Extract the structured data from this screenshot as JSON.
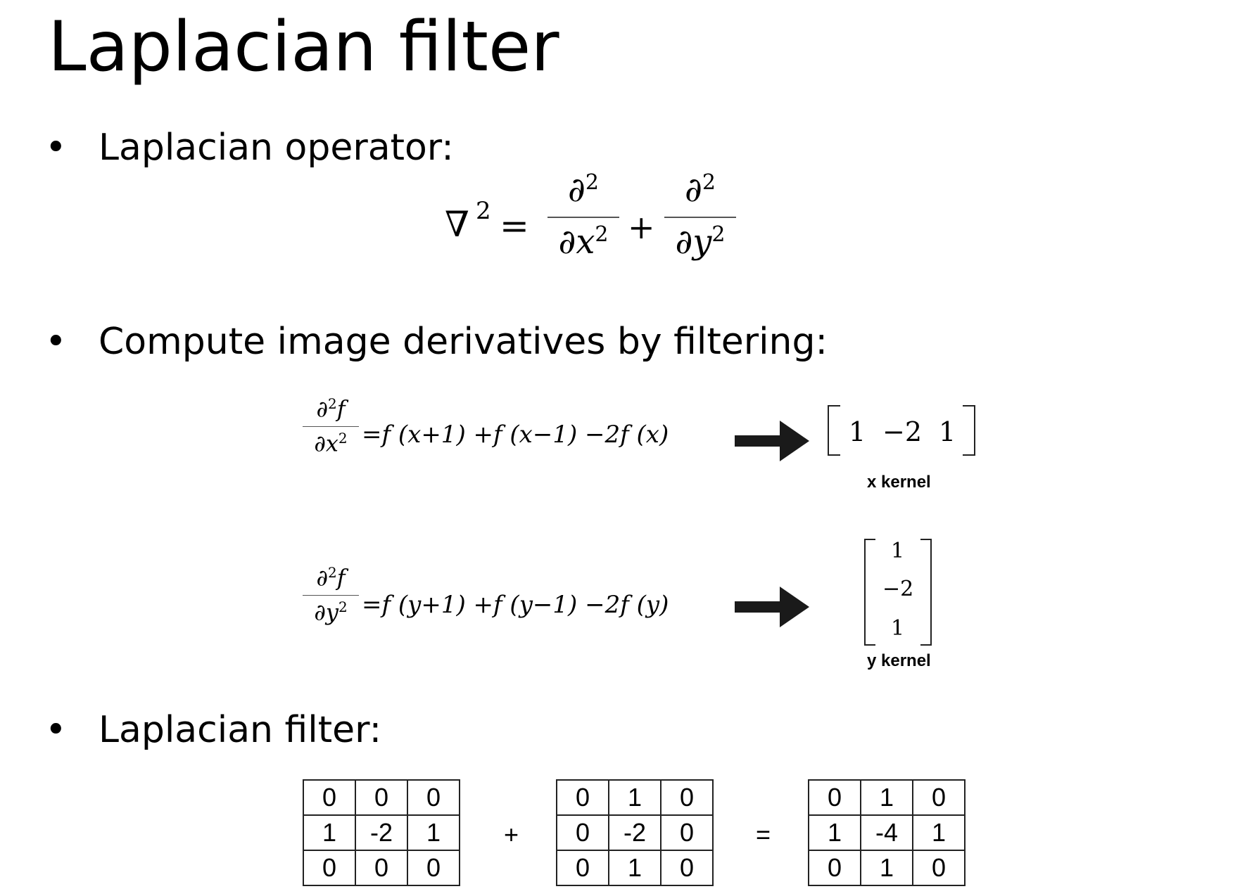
{
  "title": "Laplacian filter",
  "bullets": [
    {
      "marker": "•",
      "text": "Laplacian operator:"
    },
    {
      "marker": "•",
      "text": "Compute image derivatives by filtering:"
    },
    {
      "marker": "•",
      "text": "Laplacian filter:"
    }
  ],
  "operator": {
    "lhs": "∇",
    "lhs_sup": "2",
    "equals": "=",
    "term1_num": "∂",
    "term1_num_sup": "2",
    "term1_den": "∂x",
    "term1_den_sup": "2",
    "plus": "+",
    "term2_num": "∂",
    "term2_num_sup": "2",
    "term2_den": "∂y",
    "term2_den_sup": "2"
  },
  "derivatives": [
    {
      "num": "∂",
      "num_sup": "2",
      "num_f": "f",
      "den": "∂x",
      "den_sup": "2",
      "rhs": "=f (x+1) +f (x−1) −2f (x)",
      "kernel": [
        "1",
        "−2",
        "1"
      ],
      "kernel_label": "x kernel",
      "arrow_icon": "right-arrow-icon"
    },
    {
      "num": "∂",
      "num_sup": "2",
      "num_f": "f",
      "den": "∂y",
      "den_sup": "2",
      "rhs": "=f (y+1) +f (y−1) −2f (y)",
      "kernel": [
        "1",
        "−2",
        "1"
      ],
      "kernel_label": "y kernel",
      "arrow_icon": "right-arrow-icon"
    }
  ],
  "laplacian": {
    "matrix_x": [
      [
        "0",
        "0",
        "0"
      ],
      [
        "1",
        "-2",
        "1"
      ],
      [
        "0",
        "0",
        "0"
      ]
    ],
    "plus": "+",
    "matrix_y": [
      [
        "0",
        "1",
        "0"
      ],
      [
        "0",
        "-2",
        "0"
      ],
      [
        "0",
        "1",
        "0"
      ]
    ],
    "equals": "=",
    "matrix_result": [
      [
        "0",
        "1",
        "0"
      ],
      [
        "1",
        "-4",
        "1"
      ],
      [
        "0",
        "1",
        "0"
      ]
    ]
  }
}
